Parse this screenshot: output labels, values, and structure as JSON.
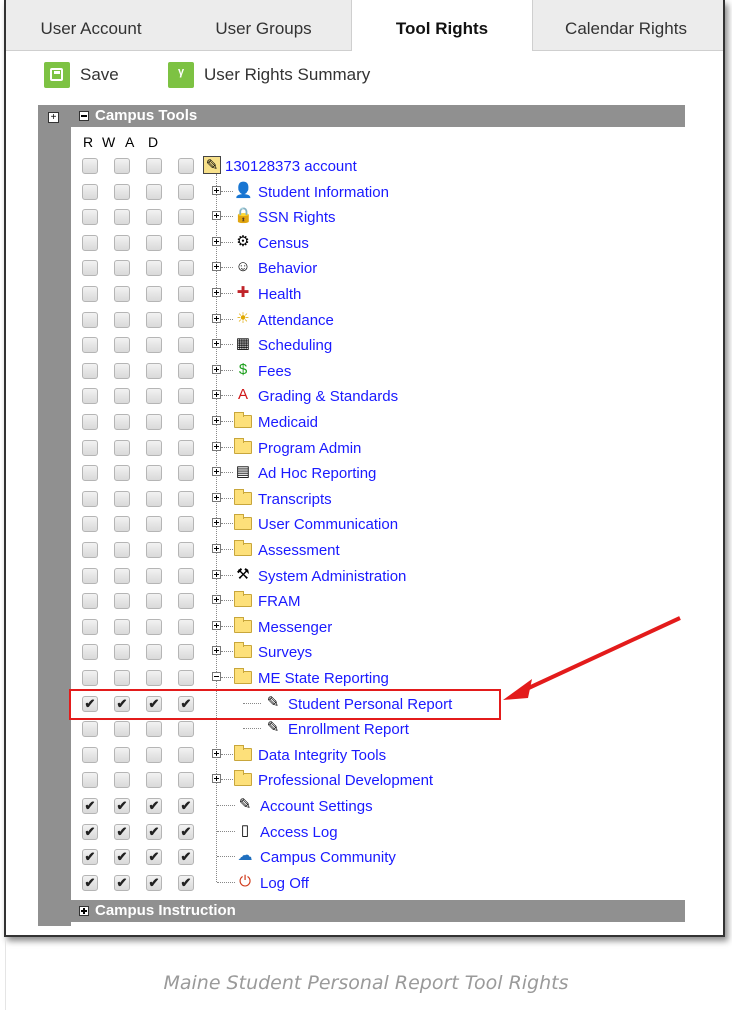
{
  "tabs": [
    {
      "label": "User Account",
      "active": false
    },
    {
      "label": "User Groups",
      "active": false
    },
    {
      "label": "Tool Rights",
      "active": true
    },
    {
      "label": "Calendar Rights",
      "active": false
    }
  ],
  "toolbar": {
    "save_label": "Save",
    "summary_label": "User Rights Summary"
  },
  "tree": {
    "campus_tools_label": "Campus Tools",
    "campus_instruction_label": "Campus Instruction",
    "rwad": [
      "R",
      "W",
      "A",
      "D"
    ],
    "root_label": "130128373 account",
    "items": [
      {
        "label": "Student Information",
        "icon": "student-icon",
        "checked": false
      },
      {
        "label": "SSN Rights",
        "icon": "lock-icon",
        "checked": false
      },
      {
        "label": "Census",
        "icon": "census-icon",
        "checked": false
      },
      {
        "label": "Behavior",
        "icon": "behavior-icon",
        "checked": false
      },
      {
        "label": "Health",
        "icon": "health-icon",
        "checked": false
      },
      {
        "label": "Attendance",
        "icon": "attendance-icon",
        "checked": false
      },
      {
        "label": "Scheduling",
        "icon": "scheduling-icon",
        "checked": false
      },
      {
        "label": "Fees",
        "icon": "fees-icon",
        "checked": false
      },
      {
        "label": "Grading & Standards",
        "icon": "grading-icon",
        "checked": false
      },
      {
        "label": "Medicaid",
        "icon": "folder-icon",
        "checked": false
      },
      {
        "label": "Program Admin",
        "icon": "folder-icon",
        "checked": false
      },
      {
        "label": "Ad Hoc Reporting",
        "icon": "adhoc-icon",
        "checked": false
      },
      {
        "label": "Transcripts",
        "icon": "folder-icon",
        "checked": false
      },
      {
        "label": "User Communication",
        "icon": "folder-icon",
        "checked": false
      },
      {
        "label": "Assessment",
        "icon": "folder-icon",
        "checked": false
      },
      {
        "label": "System Administration",
        "icon": "system-admin-icon",
        "checked": false
      },
      {
        "label": "FRAM",
        "icon": "folder-icon",
        "checked": false
      },
      {
        "label": "Messenger",
        "icon": "folder-icon",
        "checked": false
      },
      {
        "label": "Surveys",
        "icon": "folder-icon",
        "checked": false
      },
      {
        "label": "ME State Reporting",
        "icon": "folder-icon",
        "checked": false,
        "expanded": true
      },
      {
        "label": "Student Personal Report",
        "icon": "report-icon",
        "checked": true,
        "child": true
      },
      {
        "label": "Enrollment Report",
        "icon": "report-icon",
        "checked": false,
        "child": true
      },
      {
        "label": "Data Integrity Tools",
        "icon": "folder-icon",
        "checked": false
      },
      {
        "label": "Professional Development",
        "icon": "folder-icon",
        "checked": false
      },
      {
        "label": "Account Settings",
        "icon": "report-icon",
        "checked": true,
        "leaf": true
      },
      {
        "label": "Access Log",
        "icon": "page-icon",
        "checked": true,
        "leaf": true
      },
      {
        "label": "Campus Community",
        "icon": "community-icon",
        "checked": true,
        "leaf": true
      },
      {
        "label": "Log Off",
        "icon": "logoff-icon",
        "checked": true,
        "leaf": true
      }
    ]
  },
  "icons": {
    "student-icon": "👤",
    "lock-icon": "🔒",
    "census-icon": "⚙",
    "behavior-icon": "☺",
    "health-icon": "✚",
    "attendance-icon": "☀",
    "scheduling-icon": "▦",
    "fees-icon": "$",
    "grading-icon": "A",
    "adhoc-icon": "▤",
    "system-admin-icon": "⚒",
    "report-icon": "✎",
    "page-icon": "▯",
    "community-icon": "☁",
    "logoff-icon": "⏻",
    "root-icon": "✎"
  },
  "caption": "Maine Student Personal Report Tool Rights",
  "colors": {
    "accent_green": "#7dc243",
    "link_blue": "#1a1aff",
    "highlight_red": "#e31b1b",
    "section_gray": "#909090"
  }
}
